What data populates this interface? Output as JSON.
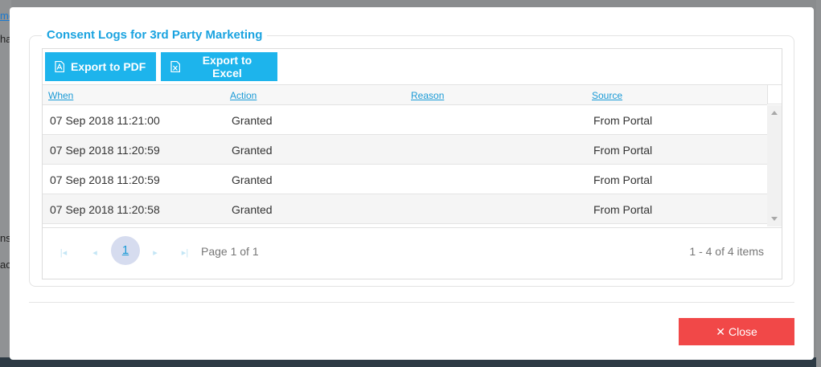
{
  "background": {
    "fragments": [
      "me",
      "hav",
      "ns",
      "ack"
    ]
  },
  "dialog": {
    "legend": "Consent Logs for 3rd Party Marketing",
    "toolbar": {
      "export_pdf": "Export to PDF",
      "export_excel": "Export to Excel",
      "pdf_icon": "pdf-file-icon",
      "excel_icon": "excel-file-icon"
    },
    "columns": [
      "When",
      "Action",
      "Reason",
      "Source"
    ],
    "rows": [
      {
        "when": "07 Sep 2018 11:21:00",
        "action": "Granted",
        "reason": "",
        "source": "From Portal"
      },
      {
        "when": "07 Sep 2018 11:20:59",
        "action": "Granted",
        "reason": "",
        "source": "From Portal"
      },
      {
        "when": "07 Sep 2018 11:20:59",
        "action": "Granted",
        "reason": "",
        "source": "From Portal"
      },
      {
        "when": "07 Sep 2018 11:20:58",
        "action": "Granted",
        "reason": "",
        "source": "From Portal"
      }
    ],
    "pager": {
      "current_page": "1",
      "page_info": "Page 1 of 1",
      "items_info": "1 - 4 of 4 items"
    },
    "close_label": "Close",
    "colors": {
      "accent": "#1db4ec",
      "legend": "#1aa3e0",
      "close": "#f14848"
    }
  }
}
